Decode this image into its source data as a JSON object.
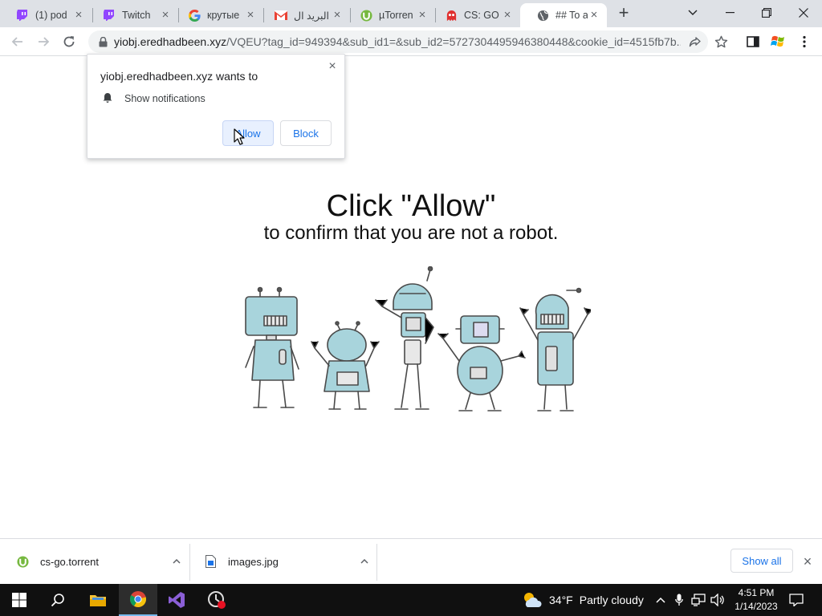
{
  "tabs": [
    {
      "title": "(1) pod",
      "icon": "twitch-icon"
    },
    {
      "title": "Twitch",
      "icon": "twitch-icon"
    },
    {
      "title": "крутые",
      "icon": "google-icon"
    },
    {
      "title": "البريد ال",
      "icon": "gmail-icon"
    },
    {
      "title": "µTorren",
      "icon": "utorrent-icon"
    },
    {
      "title": "CS: GO",
      "icon": "ghost-icon"
    },
    {
      "title": "## To a",
      "icon": "globe-icon",
      "active": true
    }
  ],
  "omnibox": {
    "url_host": "yiobj.eredhadbeen.xyz",
    "url_rest": "/VQEU?tag_id=949394&sub_id1=&sub_id2=5727304495946380448&cookie_id=4515fb7b..."
  },
  "popup": {
    "title": "yiobj.eredhadbeen.xyz wants to",
    "permission": "Show notifications",
    "allow_label": "Allow",
    "block_label": "Block"
  },
  "page": {
    "headline": "Click \"Allow\"",
    "subline": "to confirm that you are not a robot."
  },
  "downloads": {
    "items": [
      {
        "name": "cs-go.torrent",
        "icon": "utorrent-icon"
      },
      {
        "name": "images.jpg",
        "icon": "image-file-icon"
      }
    ],
    "show_all_label": "Show all"
  },
  "taskbar": {
    "weather_temp": "34°F",
    "weather_text": "Partly cloudy",
    "time": "4:51 PM",
    "date": "1/14/2023"
  },
  "colors": {
    "accent": "#1a73e8",
    "tabstrip": "#dee1e6",
    "robot_body": "#a8d4dc",
    "taskbar": "#101010"
  }
}
